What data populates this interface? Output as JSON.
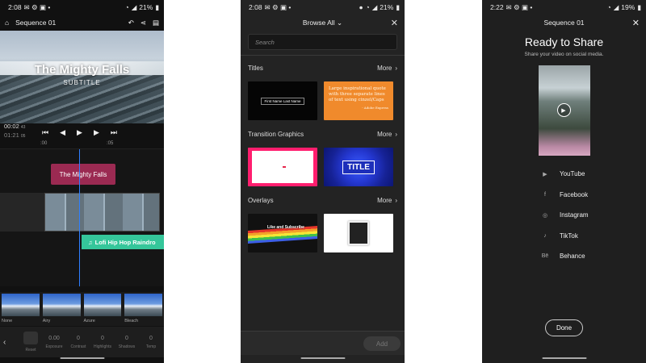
{
  "phone1": {
    "status": {
      "time": "2:08",
      "battery": "21%"
    },
    "top_bar": {
      "title": "Sequence 01"
    },
    "preview": {
      "title": "The Mighty Falls",
      "subtitle": "SUBTITLE"
    },
    "timecode": {
      "current": "00:02",
      "current_frames": "43",
      "total": "01:21",
      "total_frames": "05"
    },
    "ruler": {
      "mark_0": ":00",
      "mark_1": ":05"
    },
    "timeline": {
      "title_clip": "The Mighty Falls",
      "audio_clip": "Lofi Hip Hop Raindro"
    },
    "filters": [
      {
        "label": "None"
      },
      {
        "label": "Airy"
      },
      {
        "label": "Azure"
      },
      {
        "label": "Bleach"
      }
    ],
    "adjustments": {
      "reset": "Reset",
      "items": [
        {
          "value": "0.00",
          "label": "Exposure"
        },
        {
          "value": "0",
          "label": "Contrast"
        },
        {
          "value": "0",
          "label": "Highlights"
        },
        {
          "value": "0",
          "label": "Shadows"
        },
        {
          "value": "0",
          "label": "Temp"
        }
      ]
    }
  },
  "phone2": {
    "status": {
      "time": "2:08",
      "battery": "21%"
    },
    "header": {
      "title": "Browse All"
    },
    "search": {
      "placeholder": "Search"
    },
    "sections": [
      {
        "title": "Titles",
        "more": "More"
      },
      {
        "title": "Transition Graphics",
        "more": "More"
      },
      {
        "title": "Overlays",
        "more": "More"
      }
    ],
    "tiles": {
      "title_1": "First Name Last Name",
      "title_2": "Large inspirational quote with three separate lines of text using cinzel/Caps",
      "title_2_attr": "- Adobe Express",
      "transition_2": "TITLE",
      "overlay_1": "Like and Subscribe"
    },
    "footer": {
      "add": "Add"
    }
  },
  "phone3": {
    "status": {
      "time": "2:22",
      "battery": "19%"
    },
    "header": {
      "title": "Sequence 01"
    },
    "heading": "Ready to Share",
    "subheading": "Share your video on social media.",
    "share_targets": [
      {
        "label": "YouTube",
        "icon": "youtube-icon"
      },
      {
        "label": "Facebook",
        "icon": "facebook-icon"
      },
      {
        "label": "Instagram",
        "icon": "instagram-icon"
      },
      {
        "label": "TikTok",
        "icon": "tiktok-icon"
      },
      {
        "label": "Behance",
        "icon": "behance-icon"
      }
    ],
    "done": "Done"
  }
}
